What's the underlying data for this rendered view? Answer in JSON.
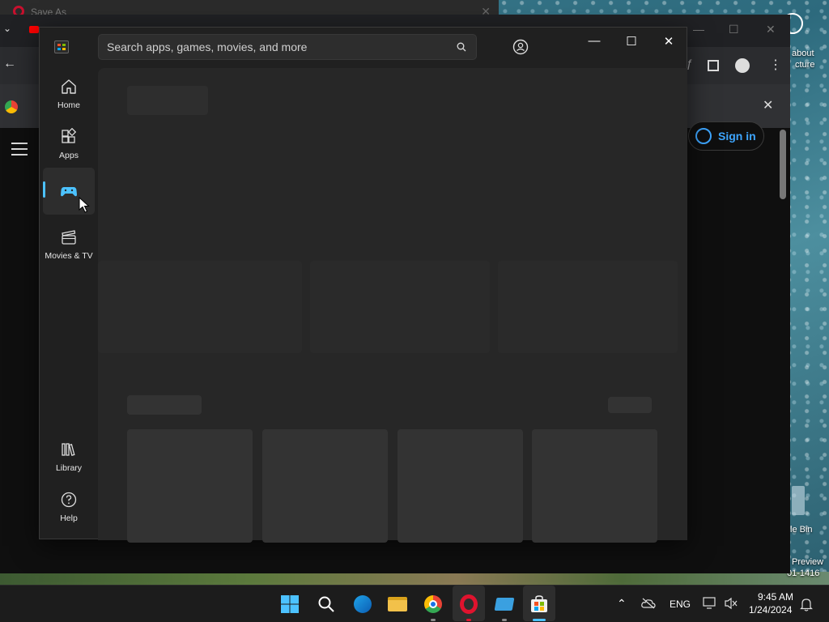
{
  "desktop": {
    "labels": [
      "about",
      "cture",
      "le Bin",
      "Preview",
      "01-1416"
    ]
  },
  "opera_window": {
    "title": "Save As"
  },
  "chrome": {
    "signin_label": "Sign in"
  },
  "store": {
    "search": {
      "placeholder": "Search apps, games, movies, and more"
    },
    "nav": {
      "home": "Home",
      "apps": "Apps",
      "gaming": "",
      "movies": "Movies & TV",
      "library": "Library",
      "help": "Help"
    },
    "active_nav": "gaming",
    "accent_color": "#4cc2ff"
  },
  "taskbar": {
    "language": "ENG",
    "time": "9:45 AM",
    "date": "1/24/2024"
  }
}
